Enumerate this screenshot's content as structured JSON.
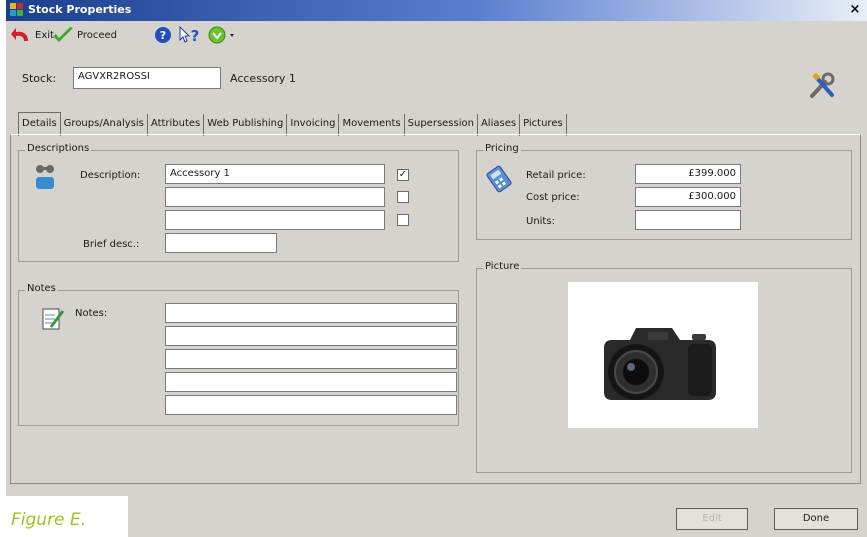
{
  "window": {
    "title": "Stock Properties",
    "close_glyph": "×"
  },
  "toolbar": {
    "exit_label": "Exit",
    "proceed_label": "Proceed",
    "help_icon": "help-icon",
    "whats_this_icon": "whats-this-icon",
    "options_icon": "options-icon"
  },
  "stock": {
    "label": "Stock:",
    "value": "AGVXR2ROSSI",
    "name": "Accessory 1"
  },
  "tabs": [
    {
      "label": "Details"
    },
    {
      "label": "Groups/Analysis"
    },
    {
      "label": "Attributes"
    },
    {
      "label": "Web Publishing"
    },
    {
      "label": "Invoicing"
    },
    {
      "label": "Movements"
    },
    {
      "label": "Supersession"
    },
    {
      "label": "Aliases"
    },
    {
      "label": "Pictures"
    }
  ],
  "descriptions": {
    "title": "Descriptions",
    "description_label": "Description:",
    "lines": [
      {
        "value": "Accessory 1",
        "checked": true
      },
      {
        "value": "",
        "checked": false
      },
      {
        "value": "",
        "checked": false
      }
    ],
    "brief_label": "Brief desc.:",
    "brief_value": ""
  },
  "notes": {
    "title": "Notes",
    "label": "Notes:",
    "lines": [
      "",
      "",
      "",
      "",
      ""
    ]
  },
  "pricing": {
    "title": "Pricing",
    "retail_label": "Retail price:",
    "retail_value": "£399.000",
    "cost_label": "Cost price:",
    "cost_value": "£300.000",
    "units_label": "Units:",
    "units_value": ""
  },
  "picture": {
    "title": "Picture"
  },
  "footer": {
    "caption": "Figure E.",
    "edit_label": "Edit",
    "done_label": "Done"
  },
  "colors": {
    "titlebar_start": "#1b3f8f",
    "caption_green": "#a3c21d",
    "window_bg": "#d6d3ce"
  }
}
